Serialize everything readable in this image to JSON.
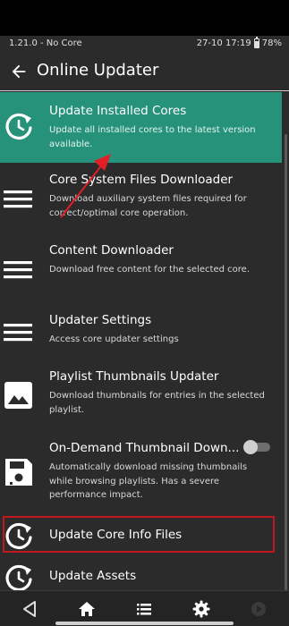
{
  "status": {
    "left": "1.21.0 - No Core",
    "right": "27-10 17:19",
    "battery": "78%",
    "battery_level": 0.78
  },
  "header": {
    "title": "Online Updater",
    "back_icon": "back-arrow-icon"
  },
  "items": [
    {
      "label": "Update Installed Cores",
      "sub": "Update all installed cores to the latest version available.",
      "icon": "update-clock-icon",
      "selected": true
    },
    {
      "label": "Core System Files Downloader",
      "sub": "Download auxiliary system files required for correct/optimal core operation.",
      "icon": "menu-lines-icon"
    },
    {
      "label": "Content Downloader",
      "sub": "Download free content for the selected core.",
      "icon": "menu-lines-icon"
    },
    {
      "label": "Updater Settings",
      "sub": "Access core updater settings",
      "icon": "menu-lines-icon"
    },
    {
      "label": "Playlist Thumbnails Updater",
      "sub": "Download thumbnails for entries in the selected playlist.",
      "icon": "image-icon"
    },
    {
      "label": "On-Demand Thumbnail Down...",
      "sub": "Automatically download missing thumbnails while browsing playlists. Has a severe performance impact.",
      "icon": "save-disk-icon",
      "toggle": false
    },
    {
      "label": "Update Core Info Files",
      "icon": "update-clock-icon"
    },
    {
      "label": "Update Assets",
      "icon": "update-clock-icon"
    }
  ],
  "nav": [
    "back-triangle-icon",
    "home-icon",
    "list-icon",
    "settings-gear-icon",
    "play-circle-icon"
  ],
  "colors": {
    "accent": "#27927a",
    "background": "#2b2b2b",
    "highlight_box": "#c0171f",
    "annotation_arrow": "#e11f26"
  }
}
